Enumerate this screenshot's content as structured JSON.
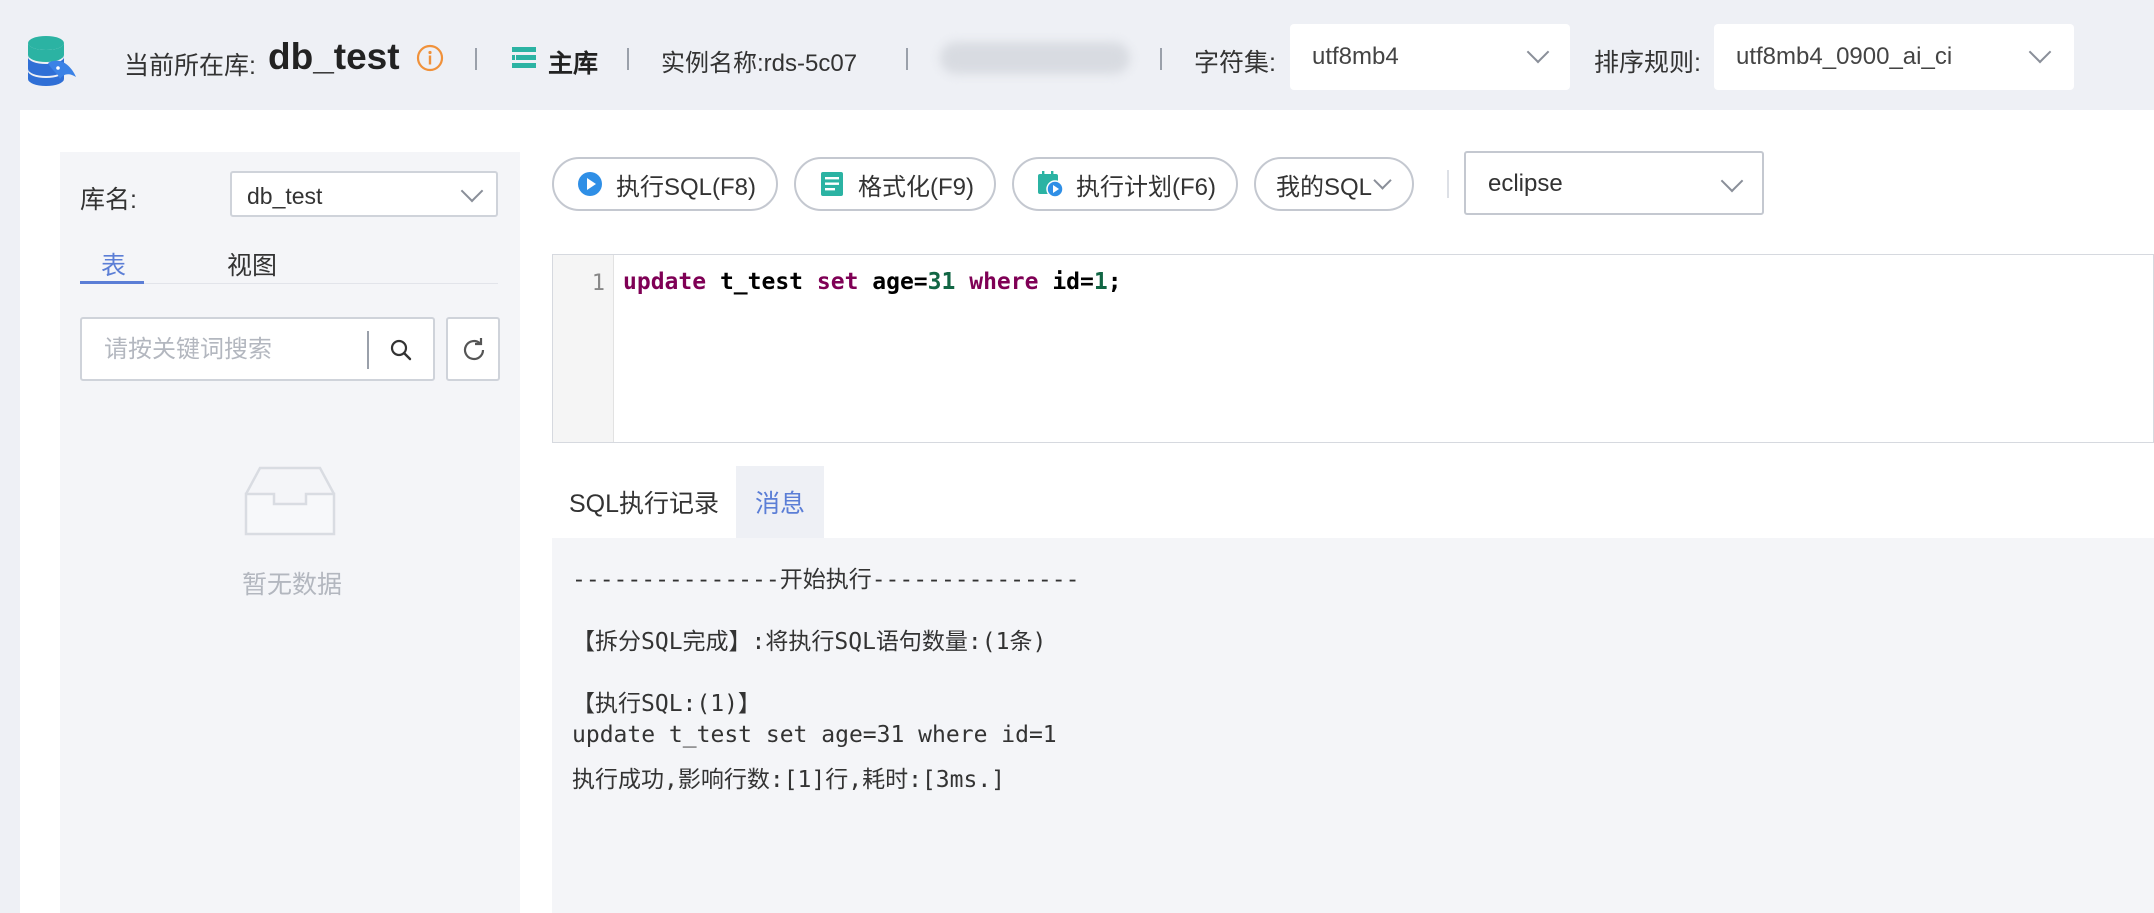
{
  "header": {
    "current_db_label": "当前所在库:",
    "db_name": "db_test",
    "master_label": "主库",
    "instance_label": "实例名称:rds-5c07",
    "charset_label": "字符集:",
    "charset_value": "utf8mb4",
    "collation_label": "排序规则:",
    "collation_value": "utf8mb4_0900_ai_ci"
  },
  "sidebar": {
    "db_label": "库名:",
    "db_value": "db_test",
    "tabs": [
      {
        "label": "表",
        "active": true
      },
      {
        "label": "视图",
        "active": false
      }
    ],
    "search_placeholder": "请按关键词搜索",
    "empty_text": "暂无数据"
  },
  "toolbar": {
    "run_sql": "执行SQL(F8)",
    "format": "格式化(F9)",
    "explain": "执行计划(F6)",
    "my_sql": "我的SQL",
    "theme": "eclipse"
  },
  "editor": {
    "line_number": "1",
    "tokens": [
      {
        "t": "update",
        "k": "kw"
      },
      {
        "t": " t_test ",
        "k": "plain"
      },
      {
        "t": "set",
        "k": "kw"
      },
      {
        "t": " age=",
        "k": "plain"
      },
      {
        "t": "31",
        "k": "num"
      },
      {
        "t": " ",
        "k": "plain"
      },
      {
        "t": "where",
        "k": "kw"
      },
      {
        "t": " id=",
        "k": "plain"
      },
      {
        "t": "1",
        "k": "num"
      },
      {
        "t": ";",
        "k": "plain"
      }
    ]
  },
  "result_tabs": [
    {
      "label": "SQL执行记录",
      "active": false
    },
    {
      "label": "消息",
      "active": true
    }
  ],
  "messages": {
    "start": "---------------开始执行---------------",
    "split": "【拆分SQL完成】:将执行SQL语句数量:(1条)",
    "exec_header": "【执行SQL:(1)】",
    "sql": "update t_test set age=31 where id=1",
    "result": "执行成功,影响行数:[1]行,耗时:[3ms.]"
  },
  "colors": {
    "accent": "#5b7ed6",
    "info_orange": "#f0913a",
    "teal": "#2bb3a3",
    "keyword": "#7f0055",
    "number": "#116644"
  }
}
